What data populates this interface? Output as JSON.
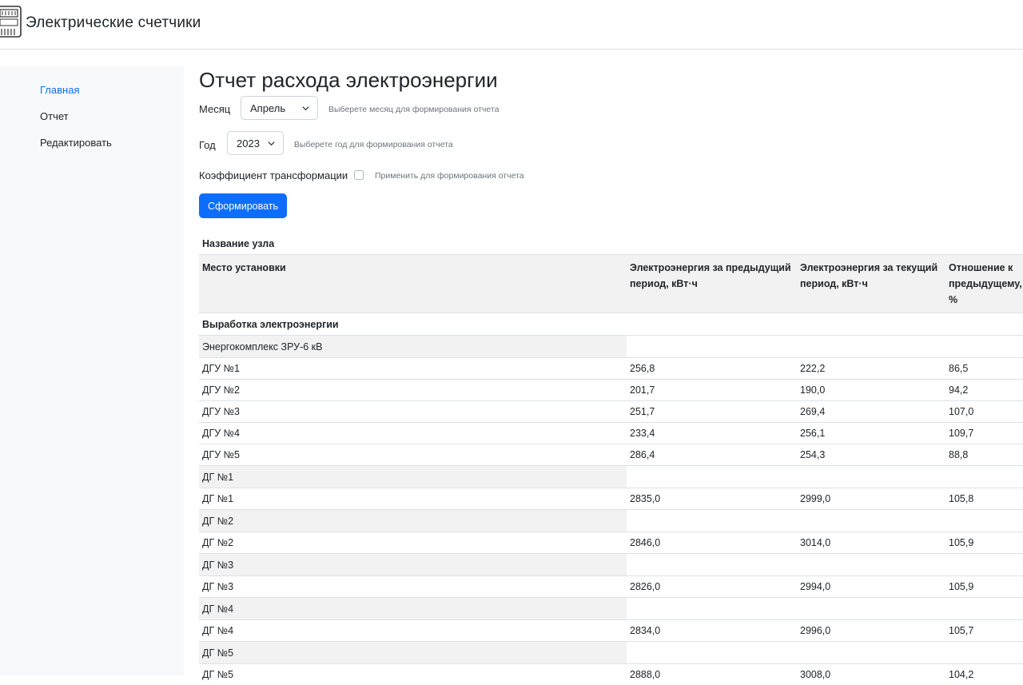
{
  "app": {
    "title": "Электрические счетчики"
  },
  "sidebar": {
    "items": [
      {
        "label": "Главная",
        "active": true
      },
      {
        "label": "Отчет",
        "active": false
      },
      {
        "label": "Редактировать",
        "active": false
      }
    ]
  },
  "page": {
    "title": "Отчет расхода электроэнергии"
  },
  "form": {
    "month": {
      "label": "Месяц",
      "value": "Апрель",
      "hint": "Выберете месяц для формирования отчета"
    },
    "year": {
      "label": "Год",
      "value": "2023",
      "hint": "Выберете год для формирования отчета"
    },
    "transform": {
      "label": "Коэффициент трансформации",
      "hint": "Применить для формирования отчета",
      "checked": false
    },
    "submit_label": "Сформировать"
  },
  "table": {
    "node_label": "Название узла",
    "columns": [
      "Место установки",
      "Электроэнергия за предыдущий период, кВт·ч",
      "Электроэнергия за текущий период, кВт·ч",
      "Отношение к предыдущему, %"
    ],
    "section": "Выработка электроэнергии",
    "groups": [
      {
        "name": "Энергокомплекс ЗРУ-6 кВ",
        "rows": [
          [
            "ДГУ №1",
            "256,8",
            "222,2",
            "86,5"
          ],
          [
            "ДГУ №2",
            "201,7",
            "190,0",
            "94,2"
          ],
          [
            "ДГУ №3",
            "251,7",
            "269,4",
            "107,0"
          ],
          [
            "ДГУ №4",
            "233,4",
            "256,1",
            "109,7"
          ],
          [
            "ДГУ №5",
            "286,4",
            "254,3",
            "88,8"
          ]
        ]
      },
      {
        "name": "ДГ №1",
        "rows": [
          [
            "ДГ №1",
            "2835,0",
            "2999,0",
            "105,8"
          ]
        ]
      },
      {
        "name": "ДГ №2",
        "rows": [
          [
            "ДГ №2",
            "2846,0",
            "3014,0",
            "105,9"
          ]
        ]
      },
      {
        "name": "ДГ №3",
        "rows": [
          [
            "ДГ №3",
            "2826,0",
            "2994,0",
            "105,9"
          ]
        ]
      },
      {
        "name": "ДГ №4",
        "rows": [
          [
            "ДГ №4",
            "2834,0",
            "2996,0",
            "105,7"
          ]
        ]
      },
      {
        "name": "ДГ №5",
        "rows": [
          [
            "ДГ №5",
            "2888,0",
            "3008,0",
            "104,2"
          ]
        ]
      }
    ]
  },
  "colors": {
    "primary": "#0d6efd",
    "sidebar_bg": "#f8f9fa",
    "header_bg": "#f2f2f2",
    "hint": "#6c757d"
  },
  "icons": {
    "logo": "electric-meter-icon",
    "select": "chevron-down-icon"
  }
}
